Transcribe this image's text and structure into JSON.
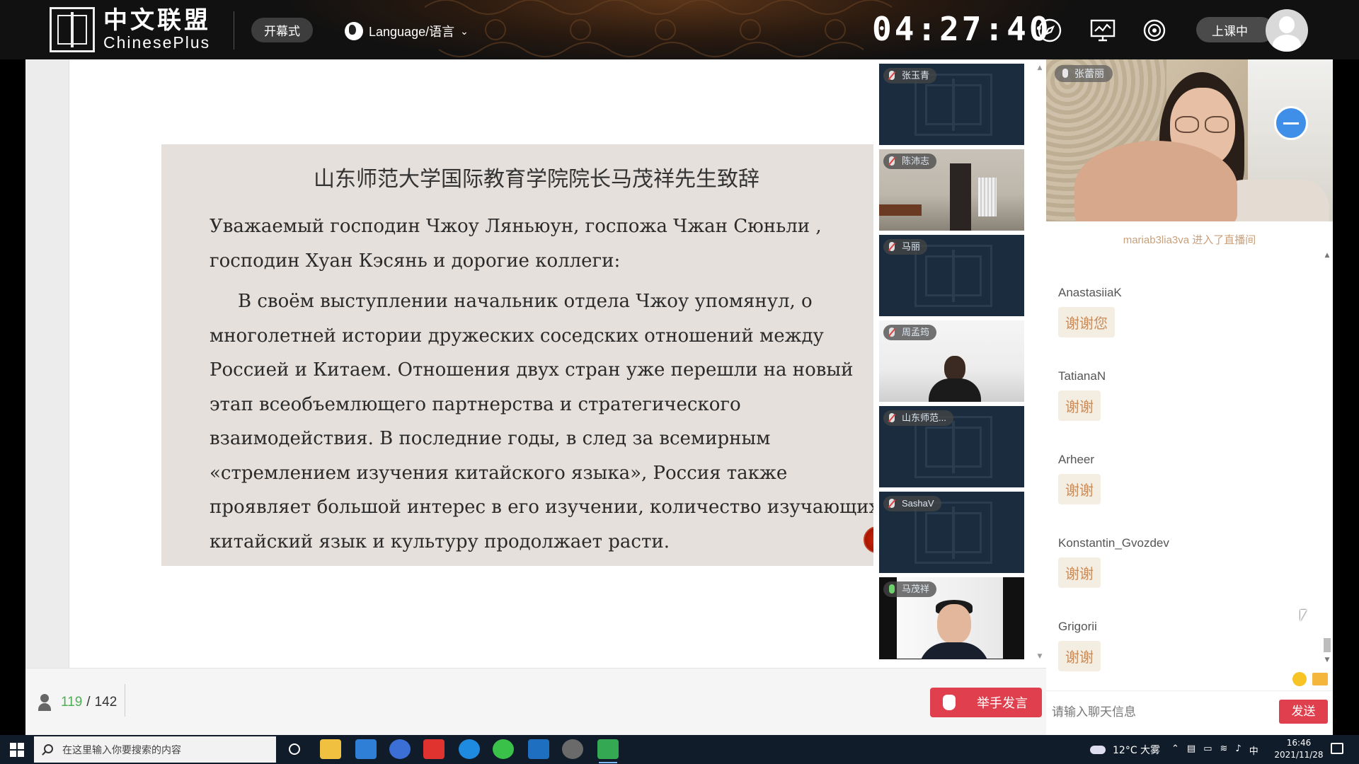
{
  "header": {
    "logo_cn": "中文联盟",
    "logo_en": "ChinesePlus",
    "open_button": "开幕式",
    "language_label": "Language/语言",
    "clock": "04:27:40",
    "status": "上课中"
  },
  "slide": {
    "title": "山东师范大学国际教育学院院长马茂祥先生致辞",
    "para1": "Уважаемый господин Чжоу Ляньюун, госпожа Чжан Сюньли , господин Хуан Кэсянь и дорогие коллеги:",
    "para2": "В своём выступлении начальник отдела Чжоу упомянул, о многолетней истории дружеских соседских отношений между Россией и Китаем.  Отношения двух  стран уже перешли на новый этап всеобъемлющего партнерства и стратегического взаимодействия. В последние годы, в след за всемирным «стремлением изучения китайского языка», Россия также проявляет большой интерес в его изучении, количество изучающих китайский язык и культуру продолжает расти."
  },
  "participants": [
    {
      "name": "张玉青"
    },
    {
      "name": "陈沛志"
    },
    {
      "name": "马丽"
    },
    {
      "name": "周孟筠"
    },
    {
      "name": "山东师范..."
    },
    {
      "name": "SashaV"
    },
    {
      "name": "马茂祥"
    }
  ],
  "host": {
    "name": "张蕾丽"
  },
  "chat": {
    "join_note": "mariab3lia3va 进入了直播间",
    "messages": [
      {
        "user": "AnastasiiaK",
        "text": "谢谢您"
      },
      {
        "user": "TatianaN",
        "text": "谢谢"
      },
      {
        "user": "Arheer",
        "text": "谢谢"
      },
      {
        "user": "Konstantin_Gvozdev",
        "text": "谢谢"
      },
      {
        "user": "Grigorii",
        "text": "谢谢"
      }
    ],
    "input_placeholder": "请输入聊天信息",
    "send_label": "发送"
  },
  "bottom": {
    "online_count": "119",
    "total_count": "142",
    "separator": "/",
    "raise_hand_label": "举手发言"
  },
  "taskbar": {
    "search_placeholder": "在这里输入你要搜索的内容",
    "weather": "12°C  大雾",
    "ime": "中",
    "time": "16:46",
    "date": "2021/11/28"
  },
  "colors": {
    "accent_red": "#e0404e",
    "online_green": "#4caf50",
    "chat_bubble_text": "#c88d5a"
  }
}
